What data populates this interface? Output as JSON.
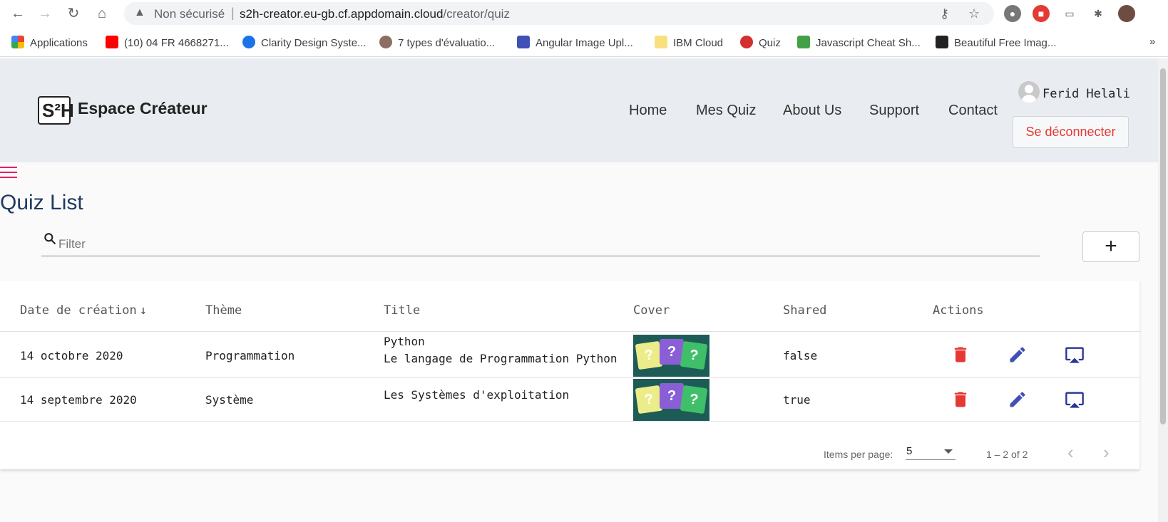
{
  "browser": {
    "insecure_label": "Non sécurisé",
    "url_host": "s2h-creator.eu-gb.cf.appdomain.cloud",
    "url_path": "/creator/quiz",
    "bookmarks": [
      {
        "label": "Applications",
        "color": "#ea4335"
      },
      {
        "label": "(10) 04 FR 4668271...",
        "color": "#ff0000"
      },
      {
        "label": "Clarity Design Syste...",
        "color": "#1a73e8"
      },
      {
        "label": "7 types d'évaluatio...",
        "color": "#8d6e63"
      },
      {
        "label": "Angular Image Upl...",
        "color": "#3f51b5"
      },
      {
        "label": "IBM Cloud",
        "color": "#f9e07f"
      },
      {
        "label": "Quiz",
        "color": "#d32f2f"
      },
      {
        "label": "Javascript Cheat Sh...",
        "color": "#43a047"
      },
      {
        "label": "Beautiful Free Imag...",
        "color": "#222222"
      }
    ]
  },
  "header": {
    "logo_text": "S²H",
    "brand": "Espace Créateur",
    "nav": [
      "Home",
      "Mes Quiz",
      "About Us",
      "Support",
      "Contact"
    ],
    "username": "Ferid Helali",
    "logout_label": "Se déconnecter"
  },
  "main": {
    "title": "Quiz List",
    "filter_placeholder": "Filter",
    "add_label": "+"
  },
  "table": {
    "columns": [
      "Date de création",
      "Thème",
      "Title",
      "Cover",
      "Shared",
      "Actions"
    ],
    "rows": [
      {
        "date": "14 octobre 2020",
        "theme": "Programmation",
        "title": "Python",
        "subtitle": "Le langage de Programmation Python",
        "shared": "false"
      },
      {
        "date": "14 septembre 2020",
        "theme": "Système",
        "title": "Les Systèmes d'exploitation",
        "subtitle": "",
        "shared": "true"
      }
    ]
  },
  "paginator": {
    "items_per_page_label": "Items per page:",
    "page_size": "5",
    "range_label": "1 – 2 of 2"
  },
  "colors": {
    "delete": "#e53935",
    "edit": "#3f51b5",
    "present": "#283593",
    "accent": "#e91e63"
  }
}
